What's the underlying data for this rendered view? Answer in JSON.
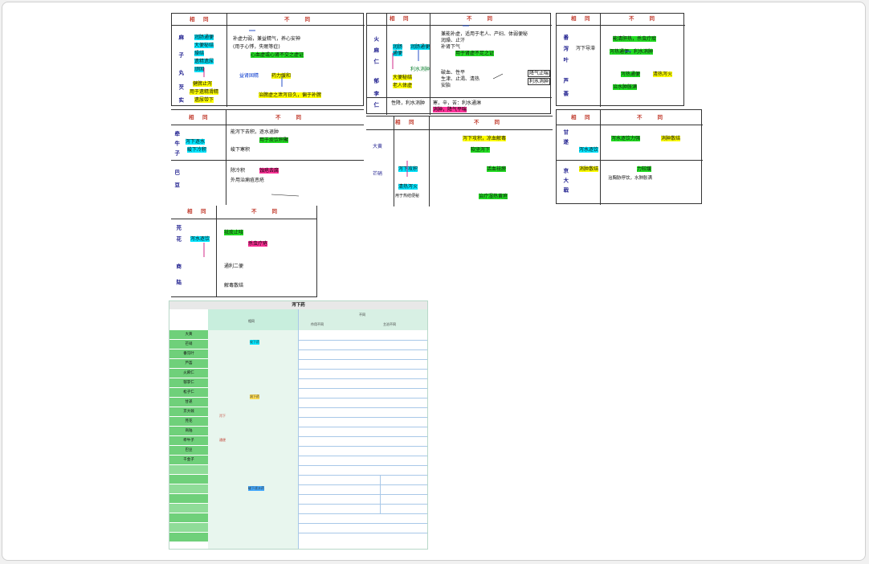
{
  "headers": {
    "same": "相　同",
    "diff": "不　　同"
  },
  "p1": {
    "col_labels": [
      "麻",
      "子",
      "丸",
      "芡",
      "实"
    ],
    "left_items": [
      "润肠通便",
      "大便秘结",
      "燥结",
      "遗精遗尿",
      "顽固"
    ],
    "left_bottom": [
      "健脾止泻",
      "用于遗精滑精",
      "遗尿带下"
    ],
    "r1": "补虚力弱，兼益精气，养心安神",
    "r1b": "(用于心悸，失眠等症)",
    "r2": "心血虚或心肾不交之虚证",
    "r3a": "益肾固精",
    "r3b": "药力缓和",
    "r4": "治脾虚之泄泻日久，偏于补脾",
    "r5": "芡实：兼补肾固精，去带"
  },
  "p2": {
    "col_labels": [
      "火",
      "麻",
      "仁",
      "郁",
      "李",
      "仁"
    ],
    "left_top": [
      "润肠",
      "通便"
    ],
    "left_mid": [
      "润肠通便"
    ],
    "left_low": [
      "大便秘结",
      "老人体虚"
    ],
    "mid_col": [
      "利水消肿"
    ],
    "r1": "兼能补虚，适用于老人、产妇、体弱便秘",
    "r1b": "润燥、止汗",
    "r1c": "补肾下气",
    "r1d": "用于肾虚不足之证",
    "r2": "破血、性平",
    "r2b": "生津、止渴、清热",
    "r2c": "安胎",
    "r3": "性降，利水消肿",
    "r4": "寒，辛，苦：利水通淋",
    "r4b": "消肿，降气平喘",
    "box_note": "降气止喘",
    "box_note2": "利水消肿"
  },
  "p3": {
    "col_labels": [
      "番",
      "泻",
      "叶",
      "芦",
      "荟"
    ],
    "left_top": [
      "泻下导滞"
    ],
    "r1": "能清肝热，杀虫疗疳",
    "r2": "泻热通便，利水消肿",
    "r3": "泻热通便",
    "r4": "清热泻火",
    "r5": "治水肿胀满"
  },
  "p4": {
    "left": [
      "牵",
      "牛",
      "子",
      "巴",
      "豆"
    ],
    "left_labels": [
      "泻下逐水",
      "峻下冷积"
    ],
    "r1": "能泻下去积，逐水退肿",
    "r2": "用于痰饮积聚",
    "r3": "峻下寒积",
    "r4": "除冷积",
    "r5": "蚀疮去腐",
    "r6": "外用治痈疽恶疮"
  },
  "p5": {
    "left": [
      "大",
      "黄",
      "芒",
      "硝"
    ],
    "left_labels": [
      "泻下攻积",
      "清热泻火",
      "用于热结便秘"
    ],
    "r1": "泻下攻积，凉血解毒",
    "r2": "软坚泻下",
    "r3": "活血祛瘀",
    "r4": "治疗湿热黄疸"
  },
  "p6": {
    "left": [
      "甘",
      "遂",
      "京",
      "大",
      "戟"
    ],
    "left_labels": [
      "泻水逐饮",
      "消肿散结"
    ],
    "r1": "泻水逐饮力强",
    "r2": "消肿散结",
    "r3": "力较缓",
    "r4": "治胸胁停饮，水肿胀满"
  },
  "p7": {
    "left": [
      "芫",
      "花",
      "商",
      "陆"
    ],
    "left_labels": [
      "泻水逐饮"
    ],
    "r1": "祛痰止咳",
    "r2": "杀虫疗疮",
    "r3": "通利二便",
    "r4": "解毒散结"
  },
  "green_table": {
    "title": "泻下药",
    "header_sub": [
      "不同",
      "作用不同",
      "主治不同"
    ],
    "rows": [
      "大黄",
      "芒硝",
      "番泻叶",
      "芦荟",
      "火麻仁",
      "郁李仁",
      "松子仁",
      "甘遂",
      "京大戟",
      "芫花",
      "商陆",
      "牵牛子",
      "巴豆",
      "千金子",
      "攻下药",
      "润下药",
      "峻下逐水药",
      "相同",
      "泻下",
      "通便"
    ]
  }
}
